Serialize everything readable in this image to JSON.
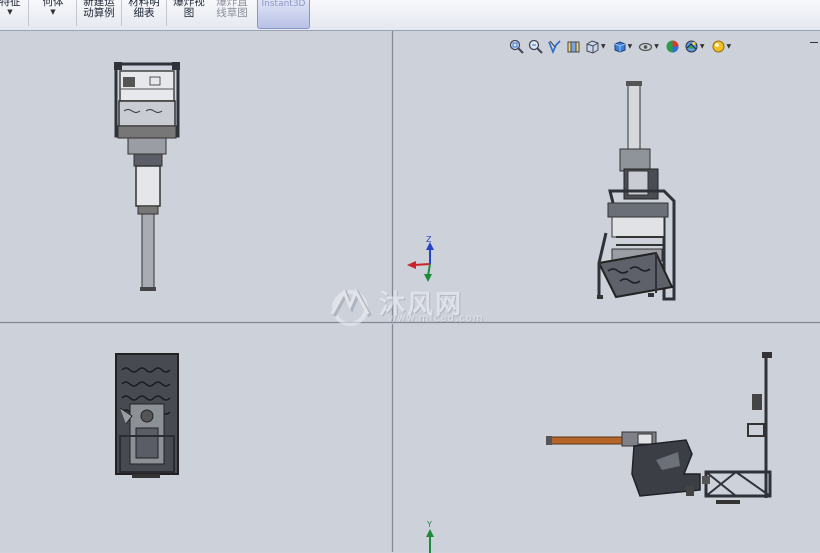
{
  "ribbon": {
    "items": [
      {
        "line1": "特征",
        "line2": ""
      },
      {
        "line1": "何体",
        "line2": ""
      },
      {
        "line1": "新建运",
        "line2": "动算例"
      },
      {
        "line1": "材料明",
        "line2": "细表"
      },
      {
        "line1": "爆炸视",
        "line2": "图"
      },
      {
        "line1": "爆炸直",
        "line2": "线草图"
      }
    ],
    "active_label": "Instant3D"
  },
  "view_toolbar": {
    "icons": [
      "zoom-to-fit-icon",
      "zoom-to-area-icon",
      "previous-view-icon",
      "section-view-icon",
      "view-orientation-icon",
      "display-style-icon",
      "hide-show-items-icon",
      "edit-appearance-icon",
      "apply-scene-icon",
      "view-settings-icon"
    ]
  },
  "viewports": [
    {
      "name": "front-view",
      "axis": "Z"
    },
    {
      "name": "isometric-view",
      "axis": ""
    },
    {
      "name": "top-view",
      "axis": ""
    },
    {
      "name": "right-view",
      "axis": "Y"
    }
  ],
  "triad": {
    "z_label": "Z",
    "y_label": "Y"
  },
  "watermark": {
    "brand": "沐风网",
    "url": "www.mfcad.com"
  },
  "colors": {
    "viewport_bg": "#cdd1da",
    "part_dark": "#3a3d44",
    "part_mid": "#8a8e96",
    "rod_orange": "#b5652a",
    "axis_blue": "#2445c8",
    "axis_red": "#c8242a",
    "axis_green": "#1f8a3a"
  }
}
